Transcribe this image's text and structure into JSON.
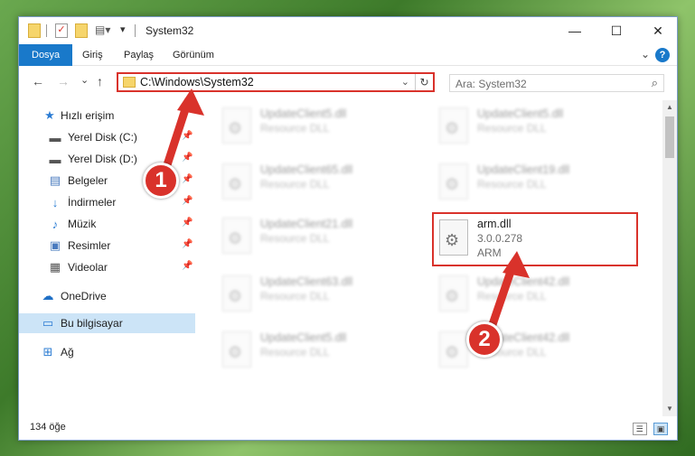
{
  "window": {
    "title": "System32",
    "controls": {
      "minimize": "—",
      "maximize": "☐",
      "close": "✕"
    }
  },
  "ribbon": {
    "tabs": [
      {
        "label": "Dosya",
        "active": true
      },
      {
        "label": "Giriş",
        "active": false
      },
      {
        "label": "Paylaş",
        "active": false
      },
      {
        "label": "Görünüm",
        "active": false
      }
    ],
    "expand": "⌄",
    "help": "?"
  },
  "nav": {
    "back": "←",
    "forward": "→",
    "recent": "⌄",
    "up": "↑",
    "address": "C:\\Windows\\System32",
    "address_dropdown": "⌄",
    "refresh": "↻",
    "search_placeholder": "Ara: System32",
    "search_icon": "⌕"
  },
  "sidebar": {
    "items": [
      {
        "label": "Hızlı erişim",
        "icon": "star-icon",
        "glyph": "★",
        "color": "#2b7cd3",
        "pinned": false
      },
      {
        "label": "Yerel Disk (C:)",
        "icon": "drive-icon",
        "glyph": "▬",
        "color": "#555555",
        "pinned": true
      },
      {
        "label": "Yerel Disk (D:)",
        "icon": "drive-icon",
        "glyph": "▬",
        "color": "#555555",
        "pinned": true
      },
      {
        "label": "Belgeler",
        "icon": "documents-icon",
        "glyph": "▤",
        "color": "#4a7bbf",
        "pinned": true
      },
      {
        "label": "İndirmeler",
        "icon": "download-icon",
        "glyph": "↓",
        "color": "#2b7cd3",
        "pinned": true
      },
      {
        "label": "Müzik",
        "icon": "music-icon",
        "glyph": "♪",
        "color": "#2b7cd3",
        "pinned": true
      },
      {
        "label": "Resimler",
        "icon": "pictures-icon",
        "glyph": "▣",
        "color": "#4a7bbf",
        "pinned": true
      },
      {
        "label": "Videolar",
        "icon": "video-icon",
        "glyph": "▦",
        "color": "#555555",
        "pinned": true
      },
      {
        "label": "OneDrive",
        "icon": "cloud-icon",
        "glyph": "☁",
        "color": "#1f6fc5",
        "pinned": false
      },
      {
        "label": "Bu bilgisayar",
        "icon": "computer-icon",
        "glyph": "▭",
        "color": "#2b7cd3",
        "pinned": false,
        "selected": true
      },
      {
        "label": "Ağ",
        "icon": "network-icon",
        "glyph": "⊞",
        "color": "#2b7cd3",
        "pinned": false
      }
    ],
    "pin_glyph": "📌"
  },
  "files": [
    {
      "name": "UpdateClient5.dll",
      "line2": "Resource DLL",
      "line3": ""
    },
    {
      "name": "UpdateClient5.dll",
      "line2": "Resource DLL",
      "line3": ""
    },
    {
      "name": "UpdateClient65.dll",
      "line2": "Resource DLL",
      "line3": ""
    },
    {
      "name": "UpdateClient19.dll",
      "line2": "Resource DLL",
      "line3": ""
    },
    {
      "name": "UpdateClient21.dll",
      "line2": "Resource DLL",
      "line3": ""
    },
    {
      "name": "arm.dll",
      "line2": "3.0.0.278",
      "line3": "ARM"
    },
    {
      "name": "UpdateClient63.dll",
      "line2": "Resource DLL",
      "line3": ""
    },
    {
      "name": "UpdateClient42.dll",
      "line2": "Resource DLL",
      "line3": ""
    },
    {
      "name": "UpdateClient5.dll",
      "line2": "Resource DLL",
      "line3": ""
    },
    {
      "name": "UpdateClient42.dll",
      "line2": "Resource DLL",
      "line3": ""
    }
  ],
  "status": {
    "count": "134 öğe",
    "details_view": "☰",
    "tiles_view": "▣"
  },
  "annotations": {
    "badge1": "1",
    "badge2": "2",
    "color": "#d9322b"
  }
}
